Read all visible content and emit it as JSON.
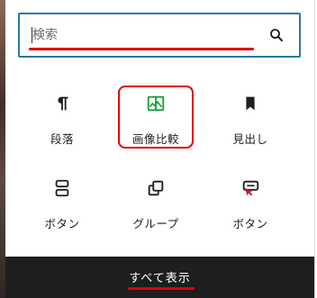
{
  "search": {
    "placeholder": "検索",
    "value": ""
  },
  "blocks": [
    {
      "label": "段落",
      "icon": "paragraph-icon"
    },
    {
      "label": "画像比較",
      "icon": "image-compare-icon"
    },
    {
      "label": "見出し",
      "icon": "bookmark-heading-icon"
    },
    {
      "label": "ボタン",
      "icon": "buttons-icon"
    },
    {
      "label": "グループ",
      "icon": "group-icon"
    },
    {
      "label": "ボタン",
      "icon": "button-cursor-icon"
    }
  ],
  "footer": {
    "show_all_label": "すべて表示"
  },
  "colors": {
    "accent_blue": "#2a7aa8",
    "annotation_red": "#e10000",
    "image_compare_green": "#1a9e3f",
    "footer_bg": "#1e1e1e"
  }
}
